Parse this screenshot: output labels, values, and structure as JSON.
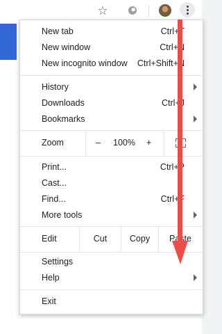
{
  "menu": {
    "new_tab": {
      "label": "New tab",
      "shortcut": "Ctrl+T"
    },
    "new_window": {
      "label": "New window",
      "shortcut": "Ctrl+N"
    },
    "new_incognito": {
      "label": "New incognito window",
      "shortcut": "Ctrl+Shift+N"
    },
    "history": {
      "label": "History"
    },
    "downloads": {
      "label": "Downloads",
      "shortcut": "Ctrl+J"
    },
    "bookmarks": {
      "label": "Bookmarks"
    },
    "zoom": {
      "label": "Zoom",
      "minus": "–",
      "level": "100%",
      "plus": "+"
    },
    "print": {
      "label": "Print...",
      "shortcut": "Ctrl+P"
    },
    "cast": {
      "label": "Cast..."
    },
    "find": {
      "label": "Find...",
      "shortcut": "Ctrl+F"
    },
    "more_tools": {
      "label": "More tools"
    },
    "edit": {
      "label": "Edit",
      "cut": "Cut",
      "copy": "Copy",
      "paste": "Paste"
    },
    "settings": {
      "label": "Settings"
    },
    "help": {
      "label": "Help"
    },
    "exit": {
      "label": "Exit"
    }
  },
  "toolbar": {
    "icons": [
      "star-icon",
      "extension-icon",
      "avatar",
      "more-vert-icon"
    ]
  },
  "colors": {
    "accent_tile": "#3367d6",
    "annotation_arrow": "#e94f46"
  }
}
